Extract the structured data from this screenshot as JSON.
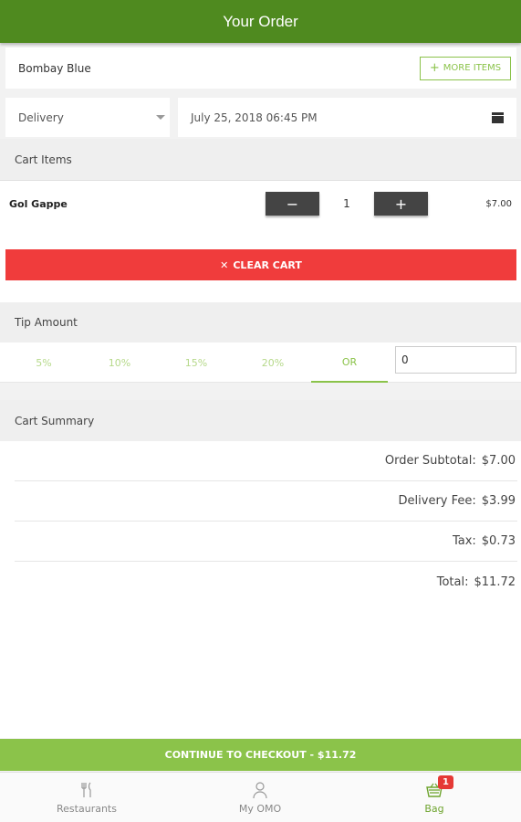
{
  "header": {
    "title": "Your Order"
  },
  "restaurant": {
    "name": "Bombay Blue",
    "more_items_label": "MORE ITEMS"
  },
  "order_options": {
    "mode": "Delivery",
    "datetime": "July 25, 2018 06:45 PM"
  },
  "cart": {
    "heading": "Cart Items",
    "items": [
      {
        "name": "Gol Gappe",
        "quantity": "1",
        "price": "$7.00"
      }
    ],
    "minus_symbol": "−",
    "plus_symbol": "+",
    "clear_cart_label": "CLEAR CART"
  },
  "tip": {
    "heading": "Tip Amount",
    "options": [
      "5%",
      "10%",
      "15%",
      "20%",
      "OR"
    ],
    "active_option": "OR",
    "custom_value": "0"
  },
  "summary": {
    "heading": "Cart Summary",
    "rows": [
      {
        "label": "Order Subtotal:",
        "value": "$7.00"
      },
      {
        "label": "Delivery Fee:",
        "value": "$3.99"
      },
      {
        "label": "Tax:",
        "value": "$0.73"
      },
      {
        "label": "Total:",
        "value": "$11.72"
      }
    ]
  },
  "checkout": {
    "label": "CONTINUE TO CHECKOUT - $11.72"
  },
  "bottom_nav": {
    "items": [
      {
        "label": "Restaurants",
        "icon": "fork-knife-icon"
      },
      {
        "label": "My OMO",
        "icon": "person-icon"
      },
      {
        "label": "Bag",
        "icon": "basket-icon",
        "badge": "1"
      }
    ]
  },
  "colors": {
    "header": "#4f8a1f",
    "accent": "#8bc34a",
    "danger": "#f03c3c"
  }
}
